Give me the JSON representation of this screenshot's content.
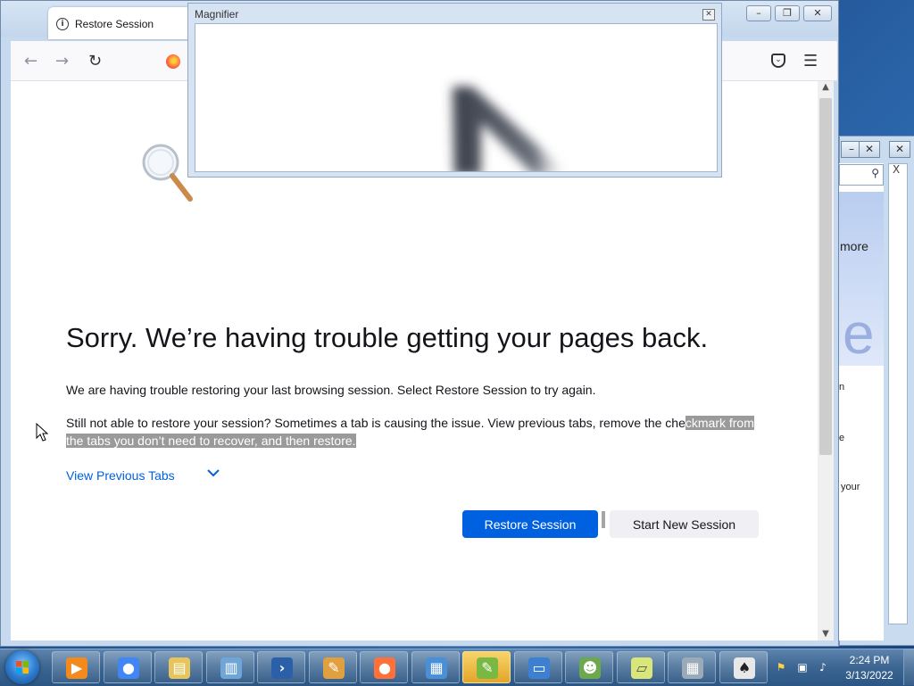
{
  "firefox": {
    "tab_title": "Restore Session",
    "heading": "Sorry. We’re having trouble getting your pages back.",
    "para1": "We are having trouble restoring your last browsing session. Select Restore Session to try again.",
    "para2_plain": "Still not able to restore your session? Sometimes a tab is causing the issue. View previous tabs, remove the che",
    "para2_selected": "ckmark from the tabs you don’t need to recover, and then restore.",
    "view_previous_tabs": "View Previous Tabs",
    "restore_button": "Restore Session",
    "new_session_button": "Start New Session"
  },
  "magnifier": {
    "title": "Magnifier"
  },
  "background_window": {
    "more_text": "more",
    "large_letter": "e",
    "fragment_1": "n",
    "fragment_2": "e",
    "fragment_3": "your"
  },
  "taskbar": {
    "items": [
      {
        "name": "media-player",
        "icon": "media-player-icon",
        "color": "#f28a1c"
      },
      {
        "name": "chrome",
        "icon": "chrome-icon",
        "color": "#4285f4"
      },
      {
        "name": "file-explorer",
        "icon": "folder-icon",
        "color": "#e8c55c"
      },
      {
        "name": "document",
        "icon": "document-icon",
        "color": "#6fa6d8"
      },
      {
        "name": "powershell",
        "icon": "powershell-icon",
        "color": "#2b5fa8"
      },
      {
        "name": "paint",
        "icon": "paint-icon",
        "color": "#e0a040"
      },
      {
        "name": "firefox",
        "icon": "firefox-icon",
        "color": "#ff7139"
      },
      {
        "name": "control-panel",
        "icon": "control-panel-icon",
        "color": "#4a90d9"
      },
      {
        "name": "notepad-plus",
        "icon": "notepad-icon",
        "color": "#79b843"
      },
      {
        "name": "remote-desktop",
        "icon": "remote-desktop-icon",
        "color": "#3d7fd1"
      },
      {
        "name": "frog-app",
        "icon": "frog-icon",
        "color": "#6ca84c"
      },
      {
        "name": "sticky-notes",
        "icon": "sticky-notes-icon",
        "color": "#d8e67a"
      },
      {
        "name": "calculator",
        "icon": "calculator-icon",
        "color": "#9aaab8"
      },
      {
        "name": "solitaire",
        "icon": "cards-icon",
        "color": "#e8e8e8"
      }
    ],
    "clock_time": "2:24 PM",
    "clock_date": "3/13/2022"
  }
}
